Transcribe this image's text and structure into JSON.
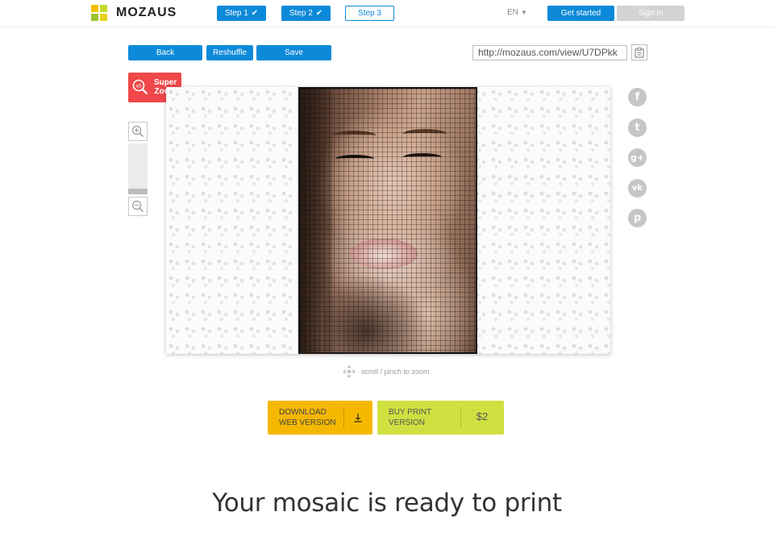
{
  "header": {
    "brand": "MOZAUS",
    "steps": [
      {
        "label": "Step 1",
        "state": "done"
      },
      {
        "label": "Step 2",
        "state": "done"
      },
      {
        "label": "Step 3",
        "state": "current"
      }
    ],
    "language": "EN",
    "get_started": "Get started",
    "sign_in": "Sign in"
  },
  "toolbar": {
    "back": "Back",
    "reshuffle": "Reshuffle",
    "save": "Save",
    "share_url": "http://mozaus.com/view/U7DPkk",
    "copy_icon": "clipboard-icon"
  },
  "super_zoom": {
    "badge": "x5",
    "line1": "Super",
    "line2": "Zoom"
  },
  "zoom": {
    "in_icon": "zoom-in-icon",
    "out_icon": "zoom-out-icon",
    "level": 0.1
  },
  "canvas": {
    "hint": "scroll / pinch to zoom"
  },
  "social": [
    {
      "name": "facebook-icon",
      "glyph": "f"
    },
    {
      "name": "twitter-icon",
      "glyph": "t"
    },
    {
      "name": "google-plus-icon",
      "glyph": "g+"
    },
    {
      "name": "vk-icon",
      "glyph": "vk"
    },
    {
      "name": "pinterest-icon",
      "glyph": "p"
    }
  ],
  "download": {
    "line1": "DOWNLOAD",
    "line2": "WEB VERSION",
    "icon": "download-icon"
  },
  "buy": {
    "line1": "BUY PRINT",
    "line2": "VERSION",
    "price": "$2"
  },
  "footer": {
    "headline": "Your mosaic is ready to print"
  },
  "colors": {
    "primary": "#0c8ad9",
    "super_zoom": "#f0484a",
    "download": "#f5b800",
    "buy": "#cfe040",
    "social": "#c6c6c6"
  }
}
